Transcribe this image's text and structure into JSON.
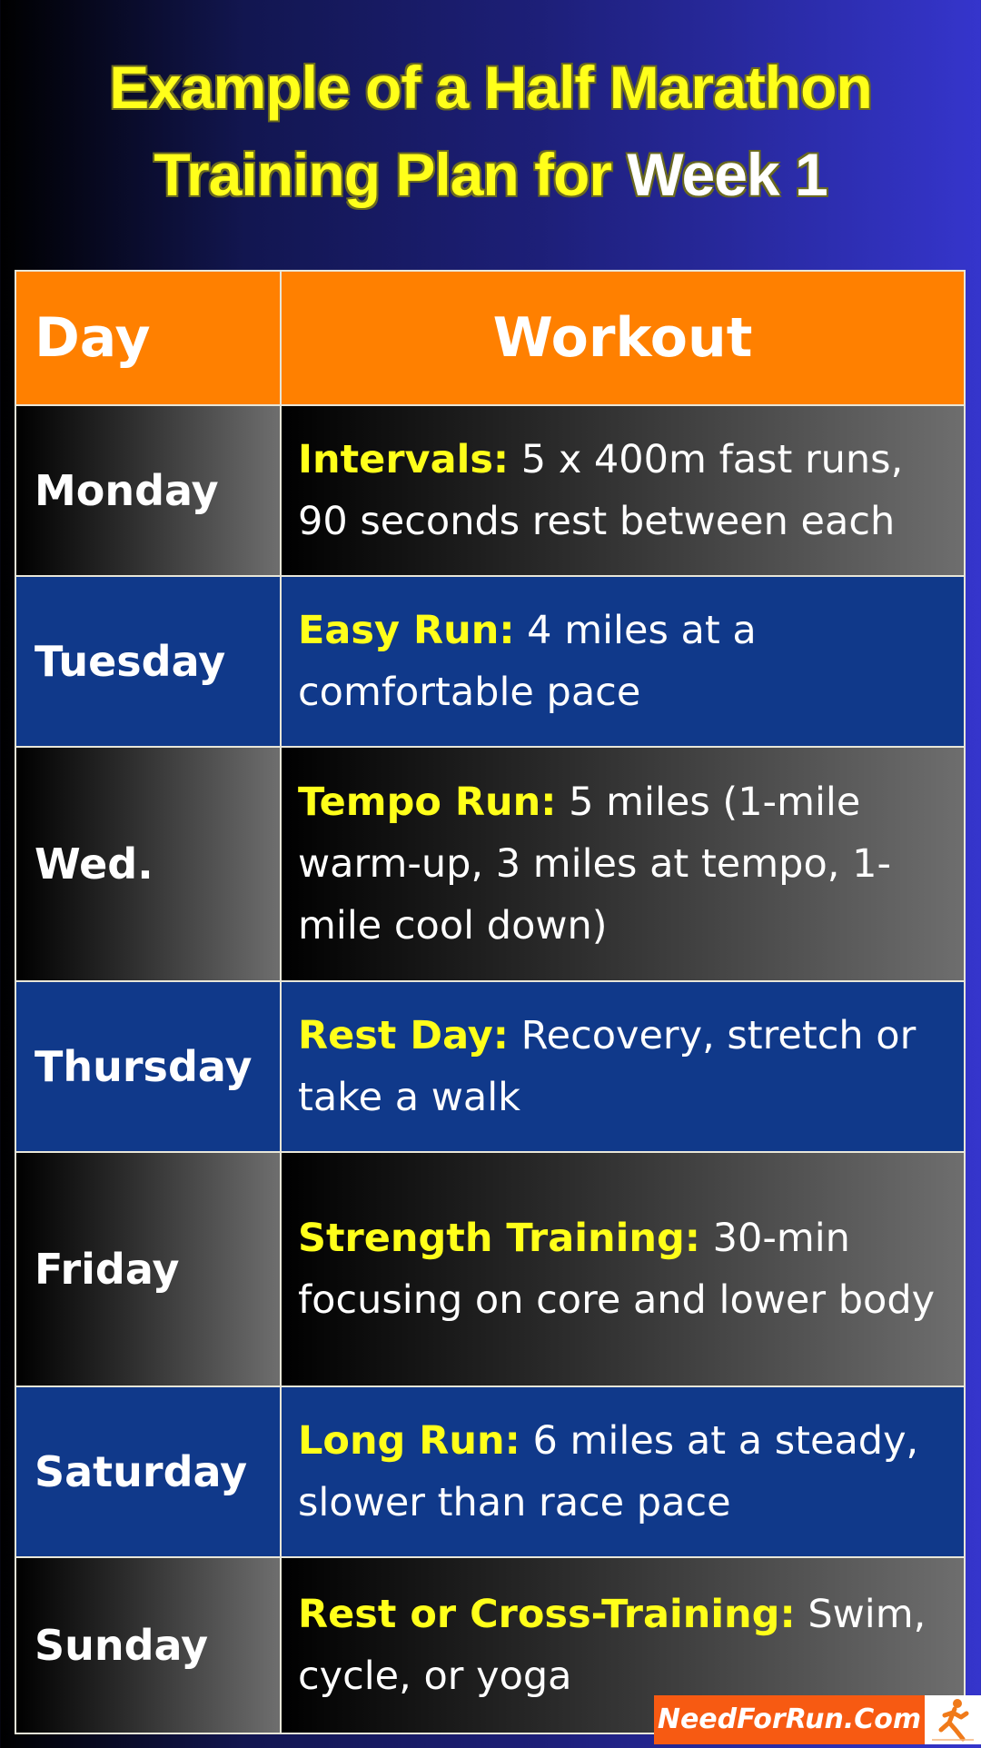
{
  "title": {
    "line1": "Example of a Half Marathon",
    "line2_part1": "Training Plan for ",
    "line2_part2": "Week 1"
  },
  "table": {
    "headers": {
      "day": "Day",
      "workout": "Workout"
    },
    "rows": [
      {
        "day": "Monday",
        "label": "Intervals:",
        "text": " 5 x 400m fast runs, 90 seconds rest between each"
      },
      {
        "day": "Tuesday",
        "label": "Easy Run:",
        "text": " 4 miles at a comfortable pace"
      },
      {
        "day": "Wed.",
        "label": "Tempo Run:",
        "text": " 5 miles (1-mile warm-up, 3 miles at tempo, 1-mile cool down)"
      },
      {
        "day": "Thursday",
        "label": "Rest Day:",
        "text": " Recovery, stretch or take a walk"
      },
      {
        "day": "Friday",
        "label": "Strength Training:",
        "text": " 30-min focusing on core and lower body"
      },
      {
        "day": "Saturday",
        "label": "Long Run:",
        "text": " 6 miles at a steady, slower than race pace"
      },
      {
        "day": "Sunday",
        "label": "Rest or Cross-Training:",
        "text": " Swim, cycle, or yoga"
      }
    ]
  },
  "branding": {
    "site": "NeedForRun.Com",
    "logo_icon": "runner-icon"
  },
  "colors": {
    "header_orange": "#ff8000",
    "label_yellow": "#ffff1a",
    "row_blue": "#10398a",
    "brand_orange": "#f75a12"
  }
}
